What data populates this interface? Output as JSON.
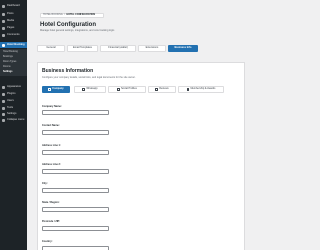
{
  "sidebar": {
    "items": [
      {
        "label": "Dashboard",
        "icon": "dashboard-icon"
      },
      {
        "label": "Posts",
        "icon": "pin-icon"
      },
      {
        "label": "Media",
        "icon": "media-icon"
      },
      {
        "label": "Pages",
        "icon": "page-icon"
      },
      {
        "label": "Comments",
        "icon": "comment-icon"
      },
      {
        "label": "Hotel Booking",
        "icon": "building-icon",
        "active": true
      },
      {
        "label": "Appearance",
        "icon": "brush-icon"
      },
      {
        "label": "Plugins",
        "icon": "plugin-icon"
      },
      {
        "label": "Users",
        "icon": "user-icon"
      },
      {
        "label": "Tools",
        "icon": "wrench-icon"
      },
      {
        "label": "Settings",
        "icon": "settings-icon"
      },
      {
        "label": "Collapse menu",
        "icon": "collapse-icon"
      }
    ],
    "submenu": [
      "Hotel Booking",
      "Bookings",
      "Room Types",
      "Rooms",
      "Settings"
    ],
    "submenu_current": 4
  },
  "breadcrumb": {
    "root": "Hotel Booking",
    "separator": "/",
    "current": "Hotel Configuration"
  },
  "header": {
    "title": "Hotel Configuration",
    "subtitle": "Manage hotel general settings, integrations, and core booking logic."
  },
  "top_tabs": [
    "General",
    "Email Templates",
    "Financial (wallet)",
    "Extensions",
    "Business Info"
  ],
  "top_tabs_active": 4,
  "card": {
    "title": "Business Information",
    "description": "Configure your company details, social links, and legal documents for the site owner."
  },
  "sub_tabs": [
    {
      "label": "Company",
      "icon": "building-icon"
    },
    {
      "label": "Whatsapp",
      "icon": "whatsapp-icon"
    },
    {
      "label": "Social Profiles",
      "icon": "share-icon"
    },
    {
      "label": "Reviews",
      "icon": "star-icon"
    },
    {
      "label": "Membership & Awards",
      "icon": "award-icon"
    }
  ],
  "sub_tabs_active": 0,
  "fields": [
    {
      "label": "Company Name:",
      "value": ""
    },
    {
      "label": "Contact Name:",
      "value": ""
    },
    {
      "label": "Address Line 1:",
      "value": ""
    },
    {
      "label": "Address Line 2:",
      "value": ""
    },
    {
      "label": "City:",
      "value": ""
    },
    {
      "label": "State / Region:",
      "value": ""
    },
    {
      "label": "Postcode / ZIP:",
      "value": ""
    },
    {
      "label": "Country:",
      "value": ""
    }
  ],
  "colors": {
    "accent": "#2271b1",
    "sidebar": "#1d2327",
    "background": "#f0f0f1"
  }
}
